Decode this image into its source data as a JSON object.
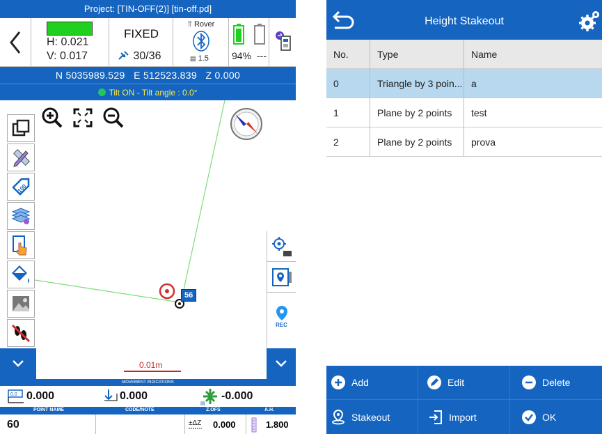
{
  "left": {
    "project_title": "Project: [TIN-OFF(2)] [tin-off.pd]",
    "status": {
      "h_value": "H: 0.021",
      "v_value": "V: 0.017",
      "fix_state": "FIXED",
      "satellites": "30/36",
      "receiver_mode": "Rover",
      "bt_signal": "1.5",
      "battery_percent": "94%",
      "battery2_text": "---"
    },
    "coordinates": "N 5035989.529   E 512523.839   Z 0.000",
    "tilt_status": "Tilt ON - Tilt angle : 0.0°",
    "map": {
      "scale_label": "0.01m",
      "point_label": "56"
    },
    "movement_title": "MOVEMENT INDICATIONS",
    "movement": {
      "horizontal": "0.000",
      "vertical": "0.000",
      "cut_fill": "-0.000"
    },
    "columns": {
      "point_name": "POINT NAME",
      "code_note": "CODE/NOTE",
      "z_ofs": "Z.OFS",
      "ah": "A.H."
    },
    "point_row": {
      "point_name": "60",
      "code_note": "",
      "z_ofs": "0.000",
      "ah": "1.800"
    },
    "colors": {
      "primary": "#1565c0",
      "fix_green": "#1ed11e",
      "tilt_text": "#ffeb3b",
      "target_red": "#d32f2f"
    }
  },
  "right": {
    "title": "Height Stakeout",
    "table": {
      "headers": [
        "No.",
        "Type",
        "Name"
      ],
      "rows": [
        {
          "no": "0",
          "type": "Triangle by 3 poin...",
          "name": "a"
        },
        {
          "no": "1",
          "type": "Plane by 2 points",
          "name": "test"
        },
        {
          "no": "2",
          "type": "Plane by 2 points",
          "name": "prova"
        }
      ]
    },
    "buttons": {
      "add": "Add",
      "edit": "Edit",
      "delete": "Delete",
      "stakeout": "Stakeout",
      "import": "Import",
      "ok": "OK"
    }
  }
}
